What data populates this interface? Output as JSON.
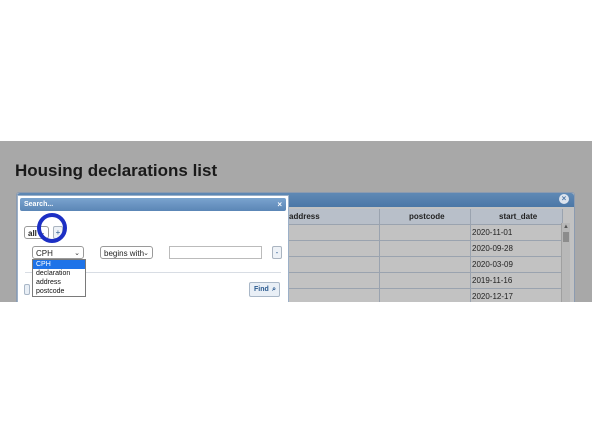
{
  "page": {
    "title": "Housing declarations list"
  },
  "grid": {
    "columns": [
      "address",
      "postcode",
      "start_date"
    ],
    "rows": [
      {
        "start_date": "2020-11-01"
      },
      {
        "start_date": "2020-09-28"
      },
      {
        "start_date": "2020-03-09"
      },
      {
        "start_date": "2019-11-16"
      },
      {
        "start_date": "2020-12-17"
      }
    ]
  },
  "search_dialog": {
    "title": "Search...",
    "close_icon": "×",
    "group_op": "all",
    "add_label": "+",
    "field_select": "CPH",
    "field_options": [
      "CPH",
      "declaration",
      "address",
      "postcode"
    ],
    "operator_select": "begins with",
    "remove_label": "-",
    "find_label": "Find",
    "find_icon": "⌕"
  },
  "colors": {
    "highlight_ring": "#1c2fc4",
    "selected_option": "#1e73e8"
  }
}
